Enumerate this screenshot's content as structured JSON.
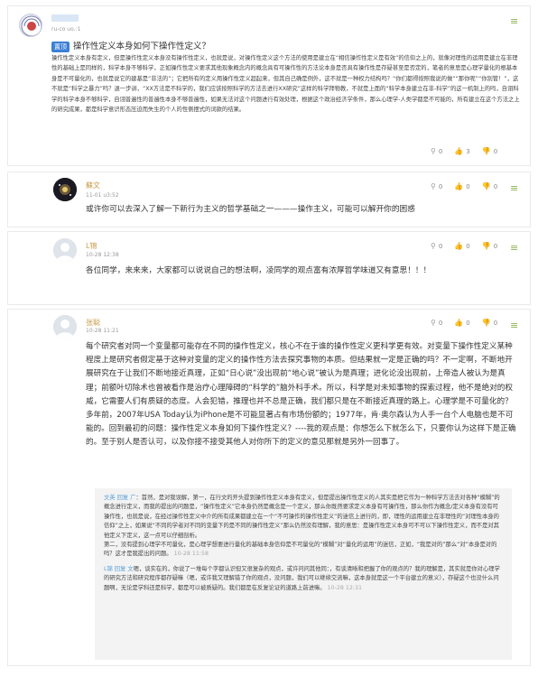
{
  "question": {
    "user": "",
    "user_meta": "ru-co uo.:1",
    "badge": "置顶",
    "title": "操作性定义本身如何下操作性定义？",
    "body": "操作性定义本身有定义，但是操作性定义本身没有操作性定义，也就是说，对操作性定义这个方法的使用是建立在“相信操作性定义是有效”的信仰之上的，就像对理性的运用是建立在非理性的基础上是同样的，科学本身不够科学，正如操作性定义要求其他现象概念内的概念具有可操作性的方法论本身是否具有操作性是存疑甚至是否定的，笔者的意思是心理学量化的根基本身是不可量化的，也就是说它的建基是“非法的”；它把所有的定义用操作性定义超起来，但其自己确是例外，这不就是一种权力结构吗？“你们都得按照我说的做”“那你呢”“你别管！”，这不就是“科学之暴力”吗？退一步讲，“XX方法是不科学的，我们应该按照科学的方法去进行XX研究”这样的科学拜物教，不就是上面的“科学本身建立在非-科学”的这一机制上的吗，自诩科学的科学本身不够科学，自诩普遍性的普遍性本身不够普遍性，如果无法对这个问题进行有效处理，根据这个政治经济学条件，那么心理学-人类学都是不可能的，所有建立在这个方法之上的研究成果，都是科学意识形态压迫而失生的个人的性侧摆式的词款的结果。",
    "stats": {
      "views": "0",
      "likes": "3",
      "dislikes": "0"
    },
    "menu_icon": "menu-icon"
  },
  "comments": [
    {
      "user": "蘇文",
      "time": "11-01 u3:52",
      "text": "或许你可以去深入了解一下新行为主义的哲学基础之一———操作主义，可能可以解开你的困惑",
      "stats": {
        "views": "0",
        "likes": "0",
        "dislikes": "0"
      }
    },
    {
      "user": "L锦",
      "time": "10-28 12:38",
      "text": "各位同学，来来来，大家都可以说说自己的想法啊，凌同学的观点富有浓厚哲学味道又有意思！！！",
      "stats": {
        "views": "0",
        "likes": "0",
        "dislikes": "0"
      }
    },
    {
      "user": "张聪",
      "time": "10-28 11:21",
      "text": "每个研究者对同一个变量都可能存在不同的操作性定义，核心不在于谁的操作性定义更科学更有效。对变量下操作性定义某种程度上是研究者假定基于这种对变量的定义的操作性方法去探究事物的本质。但结果就一定是正确的吗？不一定啊，不断地开展研究在于让我们不断地接近真理，正如“日心说”没出现前“地心说”被认为是真理；进化论没出现前，上帝造人被认为是真理；前额叶切除术也曾被看作是治疗心理障碍的“科学的”脑外科手术。所以，科学是对未知事物的探索过程，他不是绝对的权威，它需要人们有质疑的态度。人会犯错，推理也并不总是正确，我们都只是在不断接近真理的路上。心理学是不可量化的？多年前，2007年USA Today认为iPhone是不可能显著占有市场份额的；1977年，肯·奥尔森认为人手一台个人电脑也是不可能的。回到最初的问题：操作性定义本身如何下操作性定义？----我的观点是：你想怎么下就怎么下，只要你认为这样下是正确的。至于别人是否认可，以及你接不接受其他人对你所下的定义的意见那就是另外一回事了。",
      "stats": {
        "views": "0",
        "likes": "0",
        "dislikes": "0"
      },
      "replies": [
        {
          "user": "文英 回复 广",
          "text": "：首然，是对我误解，第一，在行文的开头提到操作性定义本身有定义，但是提出操作性定义的人其实是把它作为一种科学方法去对各种“模糊”的概念进行定义，而我的提出的问题是，“操作性定义”它本身仍然是概念是一个定义，那么你既然要求定义本身有可操作性，那么你作为概念/定义本身有没有可操作性，也就是说，在经过操作性定义中介的所有成果都建立在一个“不可操作的操作性定义”的迷信上进行的，即，理性的运用建立在非理性的“对理性本身的信仰”之上，如果说“不同的学者对不同的变量下的是不同的操作性定义”那么仍然没有理解，我的意思：是操作性定义本身可不可以下操作性定义，而不是对其他定义下定义，这一点可以仔细剖析。\n第二，没有提到心理学不可量化，是心理学想要进行量化的基础本身信仰是不可量化的“模糊”对“量化的运用”的迷信，正如，“我是对的”那么“对”本身是对的吗？这才是我提出的问题。",
          "time": "10-28 11:58"
        },
        {
          "user": "L锦 回复 文",
          "text": "嗯，谈实在的，你说了一堆每个字都认识但又很复杂的观点，或许问问其他同：，有谈清晰和把握了你的观点的？我的理解是，其实就是你对心理学的研究方法和研究程序都存疑嘛（嗯，或许我又理解错了你的观点，没问题，我们可以继续交流嘛，这本身就是这一个平台建立的意义），存疑这个也没什么问题啊，无论是学科还是科学，都是可以被质疑的。我们都是在反复论证的道路上前进嘛。",
          "time": "10-28 12:31"
        }
      ]
    }
  ]
}
